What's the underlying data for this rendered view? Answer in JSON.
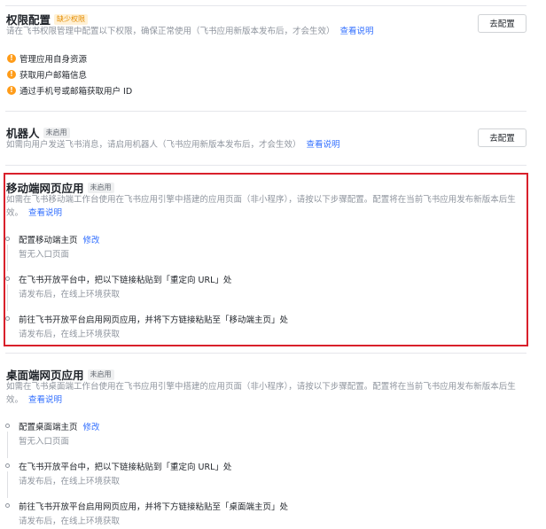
{
  "permissions": {
    "title": "权限配置",
    "tag": "缺少权限",
    "desc": "请在飞书权限管理中配置以下权限，确保正常使用（飞书应用新版本发布后，才会生效）",
    "link": "查看说明",
    "button": "去配置",
    "items": [
      "管理应用自身资源",
      "获取用户邮箱信息",
      "通过手机号或邮箱获取用户 ID"
    ]
  },
  "robot": {
    "title": "机器人",
    "tag": "未启用",
    "desc": "如需向用户发送飞书消息，请启用机器人（飞书应用新版本发布后，才会生效）",
    "link": "查看说明",
    "button": "去配置"
  },
  "mobile": {
    "title": "移动端网页应用",
    "tag": "未启用",
    "desc": "如需在飞书移动端工作台使用在飞书应用引擎中搭建的应用页面（非小程序），请按以下步骤配置。配置将在当前飞书应用发布新版本后生效。",
    "link": "查看说明",
    "steps": [
      {
        "title": "配置移动端主页",
        "link": "修改",
        "sub": "暂无入口页面"
      },
      {
        "title": "在飞书开放平台中，把以下链接粘贴到「重定向 URL」处",
        "sub": "请发布后，在线上环境获取"
      },
      {
        "title": "前往飞书开放平台启用网页应用，并将下方链接粘贴至「移动端主页」处",
        "sub": "请发布后，在线上环境获取"
      }
    ]
  },
  "desktop": {
    "title": "桌面端网页应用",
    "tag": "未启用",
    "desc": "如需在飞书桌面端工作台使用在飞书应用引擎中搭建的应用页面（非小程序），请按以下步骤配置。配置将在当前飞书应用发布新版本后生效。",
    "link": "查看说明",
    "steps": [
      {
        "title": "配置桌面端主页",
        "link": "修改",
        "sub": "暂无入口页面"
      },
      {
        "title": "在飞书开放平台中，把以下链接粘贴到「重定向 URL」处",
        "sub": "请发布后，在线上环境获取"
      },
      {
        "title": "前往飞书开放平台启用网页应用，并将下方链接粘贴至「桌面端主页」处",
        "sub": "请发布后，在线上环境获取"
      }
    ]
  }
}
